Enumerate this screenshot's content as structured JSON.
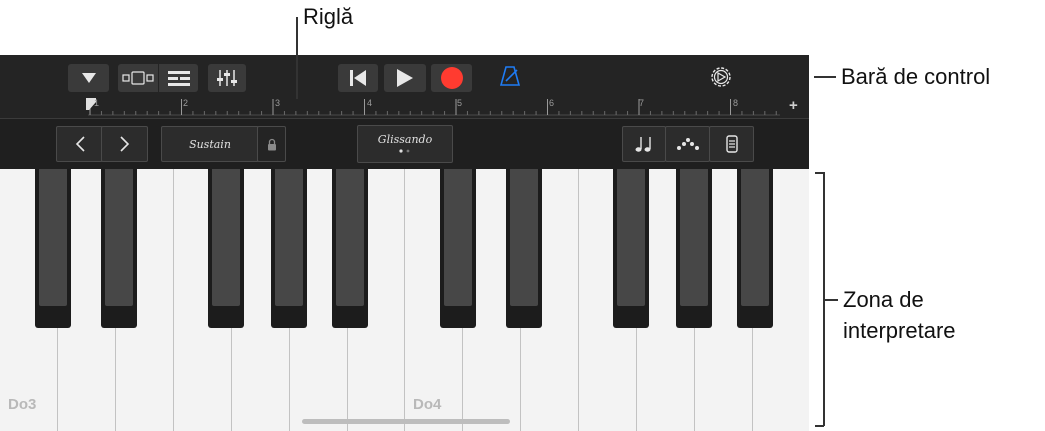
{
  "annotations": {
    "ruler": "Riglă",
    "control_bar": "Bară de control",
    "play_zone_line1": "Zona de",
    "play_zone_line2": "interpretare"
  },
  "ruler": {
    "ticks": [
      "1",
      "2",
      "3",
      "4",
      "5",
      "6",
      "7",
      "8"
    ],
    "add_label": "+"
  },
  "secondary_bar": {
    "sustain_label": "Sustain",
    "glissando_label": "Glissando"
  },
  "keyboard": {
    "labels": [
      "Do3",
      "Do4"
    ]
  },
  "colors": {
    "record": "#ff3b30",
    "metronome": "#1e7cf5"
  }
}
